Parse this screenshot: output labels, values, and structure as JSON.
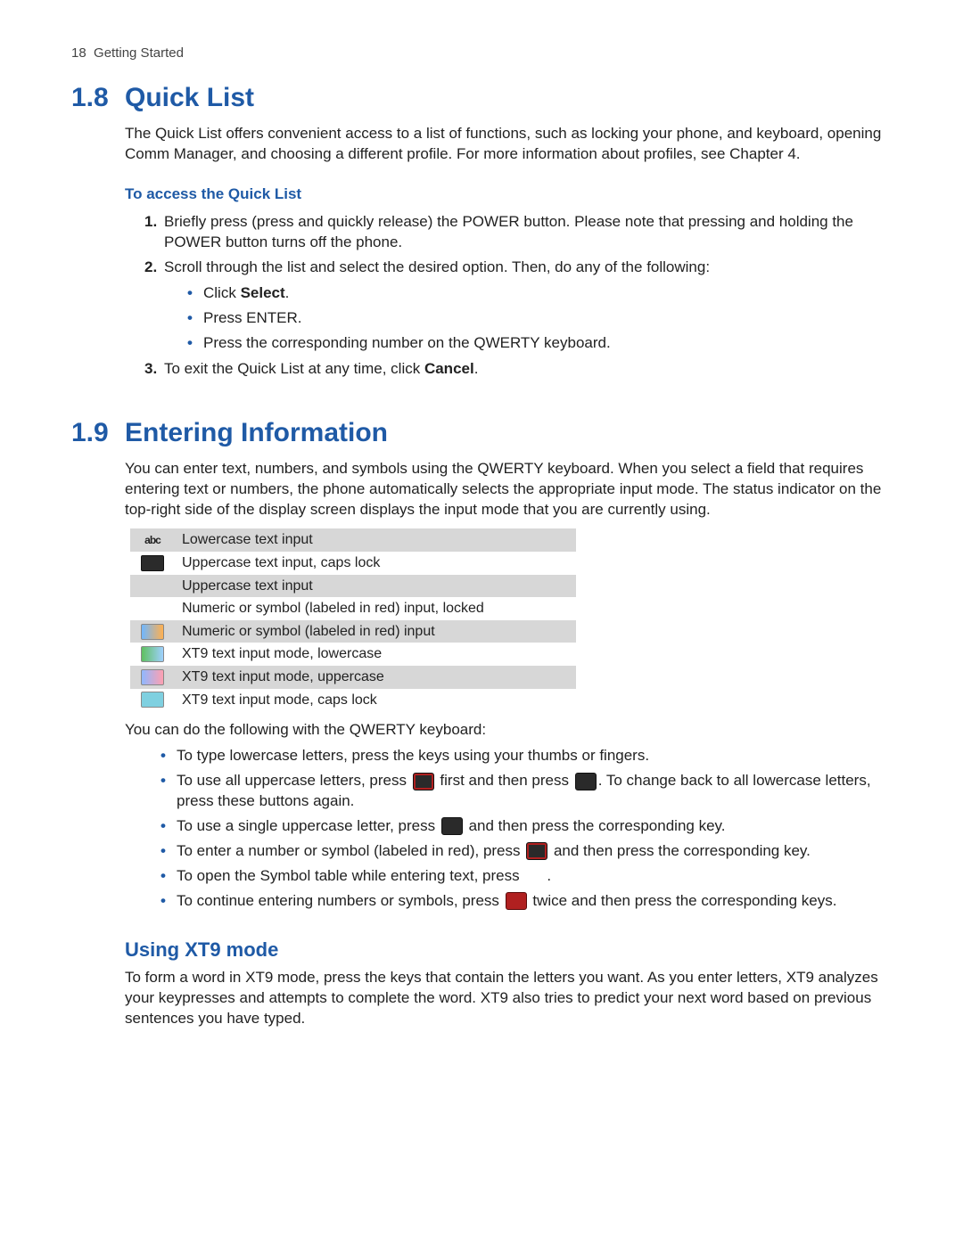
{
  "runningHead": {
    "page": "18",
    "chapter": "Getting Started"
  },
  "sections": {
    "s18": {
      "num": "1.8",
      "title": "Quick List",
      "intro": "The Quick List offers convenient access to a list of functions, such as locking your phone, and keyboard, opening Comm Manager, and choosing a different profile. For more information about profiles, see Chapter 4.",
      "sub1": "To access the Quick List",
      "step1": "Briefly press (press and quickly release) the POWER button. Please note that pressing and holding the POWER button turns off the phone.",
      "step2": "Scroll through the list and select the desired option. Then, do any of the following:",
      "bullets2": {
        "a_pre": "Click ",
        "a_bold": "Select",
        "a_post": ".",
        "b": "Press ENTER.",
        "c": "Press the corresponding number on the QWERTY keyboard."
      },
      "step3_pre": "To exit the Quick List at any time, click ",
      "step3_bold": "Cancel",
      "step3_post": "."
    },
    "s19": {
      "num": "1.9",
      "title": "Entering Information",
      "intro": "You can enter text, numbers, and symbols using the QWERTY keyboard. When you select a field that requires entering text or numbers, the phone automatically selects the appropriate input mode. The status indicator on the top-right side of the display screen displays the input mode that you are currently using.",
      "modes": [
        {
          "icon": "abc",
          "label": "Lowercase text input"
        },
        {
          "icon": "dark",
          "label": "Uppercase text input, caps lock"
        },
        {
          "icon": "",
          "label": "Uppercase text input"
        },
        {
          "icon": "",
          "label": "Numeric or symbol (labeled in red) input, locked"
        },
        {
          "icon": "sym1",
          "label": "Numeric or symbol (labeled in red) input"
        },
        {
          "icon": "xt9l",
          "label": "XT9 text input mode, lowercase"
        },
        {
          "icon": "xt9u",
          "label": "XT9 text input mode, uppercase"
        },
        {
          "icon": "xt9c",
          "label": "XT9 text input mode, caps lock"
        }
      ],
      "after_table": "You can do the following with the QWERTY keyboard:",
      "kbullets": {
        "b1": "To type lowercase letters, press the keys using your thumbs or fingers.",
        "b2a": "To use all uppercase letters, press ",
        "b2b": " first and then press ",
        "b2c": ". To change back to all lowercase letters, press these buttons again.",
        "b3a": "To use a single uppercase letter, press ",
        "b3b": " and then press the corresponding key.",
        "b4a": "To enter a number or symbol (labeled in red), press ",
        "b4b": " and then press the corresponding key.",
        "b5a": "To open the Symbol table while entering text, press ",
        "b5b": ".",
        "b6a": "To continue entering numbers or symbols, press ",
        "b6b": " twice and then press the corresponding keys."
      },
      "h2": "Using XT9 mode",
      "xt9p": "To form a word in XT9 mode, press the keys that contain the letters you want. As you enter letters, XT9 analyzes your keypresses and attempts to complete the word. XT9 also tries to predict your next word based on previous sentences you have typed."
    }
  }
}
